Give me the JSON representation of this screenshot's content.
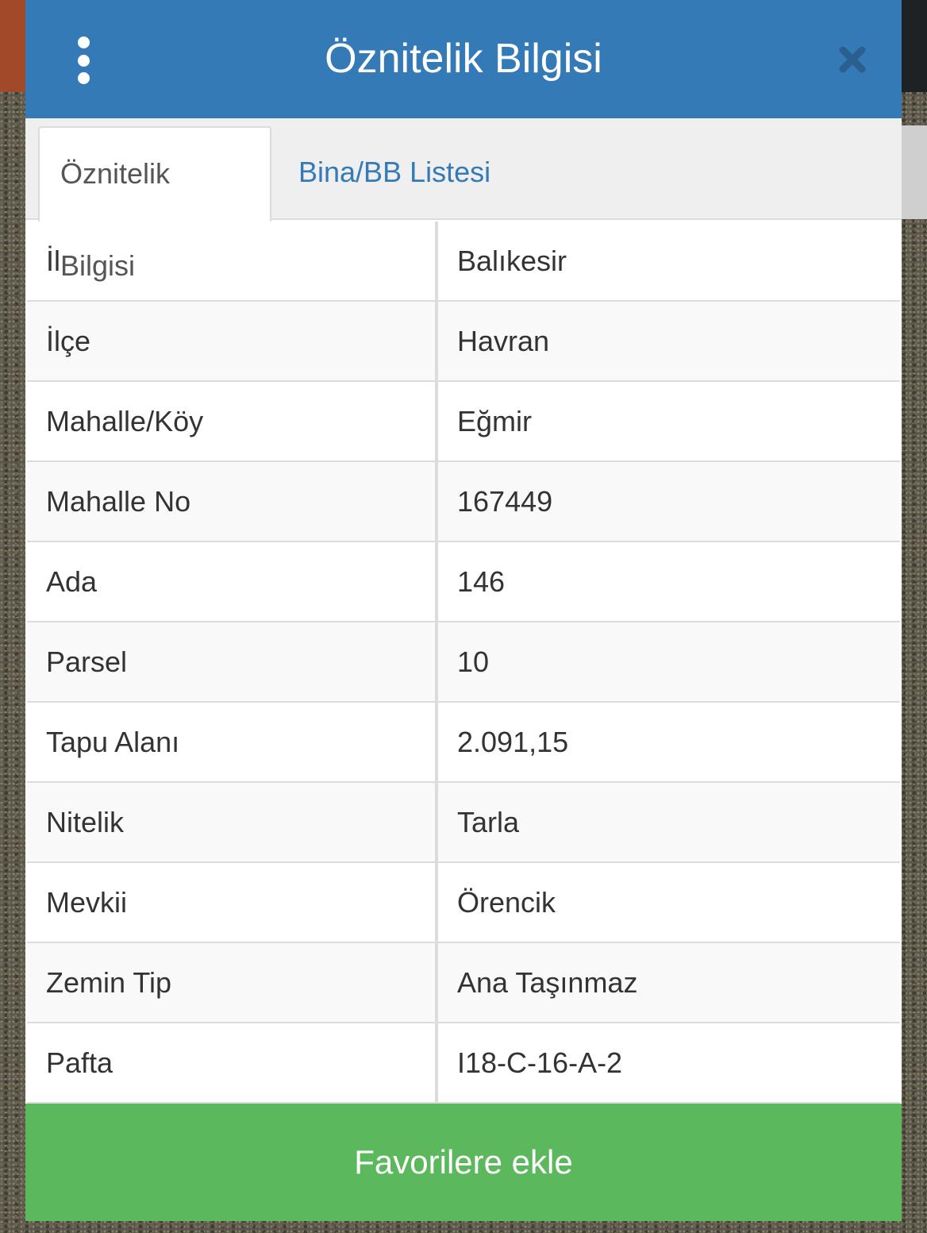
{
  "header": {
    "title": "Öznitelik Bilgisi",
    "menu_icon": "vertical-ellipsis",
    "close_icon": "close-x"
  },
  "tabs": [
    {
      "label": "Öznitelik Bilgisi",
      "active": true
    },
    {
      "label": "Bina/BB Listesi",
      "active": false
    }
  ],
  "attributes": [
    {
      "key": "İl",
      "value": "Balıkesir"
    },
    {
      "key": "İlçe",
      "value": "Havran"
    },
    {
      "key": "Mahalle/Köy",
      "value": "Eğmir"
    },
    {
      "key": "Mahalle No",
      "value": "167449"
    },
    {
      "key": "Ada",
      "value": "146"
    },
    {
      "key": "Parsel",
      "value": "10"
    },
    {
      "key": "Tapu Alanı",
      "value": "2.091,15"
    },
    {
      "key": "Nitelik",
      "value": "Tarla"
    },
    {
      "key": "Mevkii",
      "value": "Örencik"
    },
    {
      "key": "Zemin Tip",
      "value": "Ana Taşınmaz"
    },
    {
      "key": "Pafta",
      "value": "I18-C-16-A-2"
    }
  ],
  "footer": {
    "button_label": "Favorilere ekle"
  },
  "colors": {
    "header": "#337ab7",
    "tab_link": "#337ab7",
    "footer_button": "#5cb85c"
  }
}
